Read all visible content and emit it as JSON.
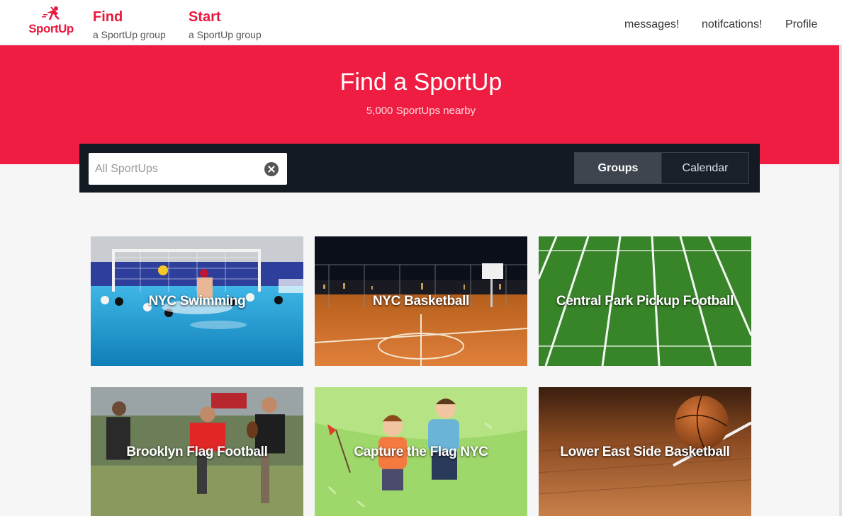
{
  "header": {
    "logo_text": "SportUp",
    "find": {
      "label": "Find",
      "sub": "a SportUp group"
    },
    "start": {
      "label": "Start",
      "sub": "a SportUp group"
    },
    "messages": "messages!",
    "notifications": "notifcations!",
    "profile": "Profile"
  },
  "hero": {
    "title": "Find a SportUp",
    "subtitle": "5,000 SportUps nearby"
  },
  "toolbar": {
    "search_placeholder": "All SportUps",
    "groups_label": "Groups",
    "calendar_label": "Calendar"
  },
  "groups": [
    {
      "title": "NYC Swimming",
      "image": "water-polo"
    },
    {
      "title": "NYC Basketball",
      "image": "night-basketball-court"
    },
    {
      "title": "Central Park Pickup Football",
      "image": "football-field"
    },
    {
      "title": "Brooklyn Flag Football",
      "image": "flag-football-players"
    },
    {
      "title": "Capture the Flag NYC",
      "image": "capture-the-flag-cartoon"
    },
    {
      "title": "Lower East Side Basketball",
      "image": "basketball-on-wood-floor"
    }
  ],
  "colors": {
    "brand": "#e8193e",
    "hero": "#ef1d42",
    "toolbar": "#141a22"
  }
}
